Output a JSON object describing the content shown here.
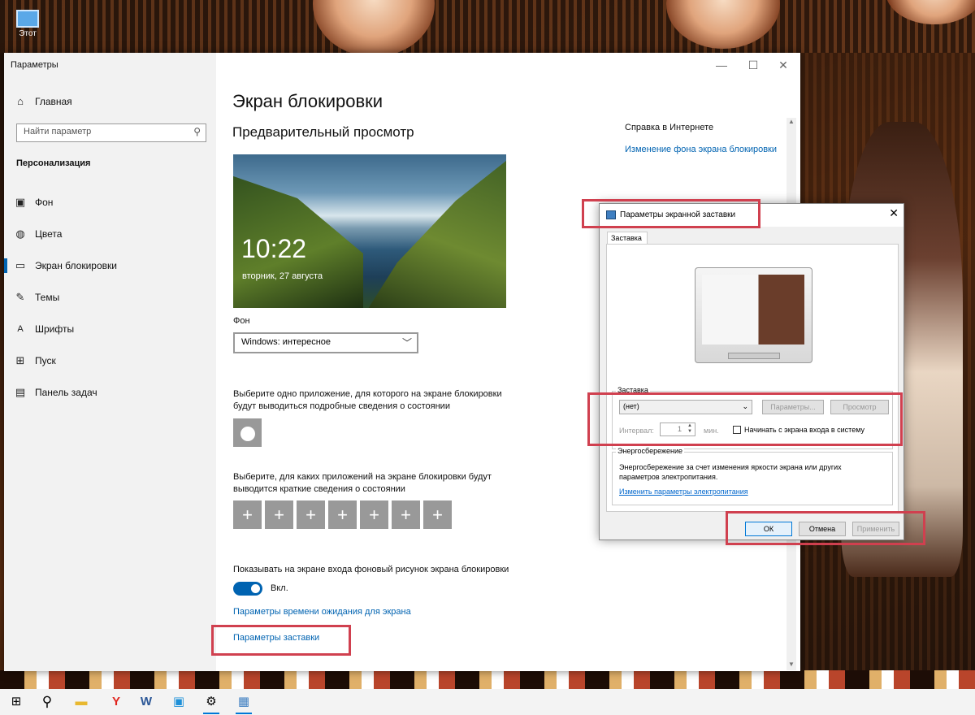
{
  "desktop": {
    "icon_label": "Этот"
  },
  "settings_window": {
    "title": "Параметры",
    "controls": {
      "minimize": "—",
      "maximize": "☐",
      "close": "✕"
    },
    "sidebar": {
      "home": "Главная",
      "search_placeholder": "Найти параметр",
      "section": "Персонализация",
      "items": [
        {
          "label": "Фон",
          "icon": "image-icon"
        },
        {
          "label": "Цвета",
          "icon": "palette-icon"
        },
        {
          "label": "Экран блокировки",
          "icon": "lockscreen-icon"
        },
        {
          "label": "Темы",
          "icon": "themes-icon"
        },
        {
          "label": "Шрифты",
          "icon": "fonts-icon"
        },
        {
          "label": "Пуск",
          "icon": "start-icon"
        },
        {
          "label": "Панель задач",
          "icon": "taskbar-icon"
        }
      ]
    },
    "main": {
      "title": "Экран блокировки",
      "preview_heading": "Предварительный просмотр",
      "preview_time": "10:22",
      "preview_date": "вторник, 27 августа",
      "background_label": "Фон",
      "background_value": "Windows: интересное",
      "detailed_status_text": "Выберите одно приложение, для которого на экране блокировки будут выводиться подробные сведения о состоянии",
      "quick_status_text": "Выберите, для каких приложений на экране блокировки будут выводится краткие сведения о состоянии",
      "quick_tiles": [
        "+",
        "+",
        "+",
        "+",
        "+",
        "+",
        "+"
      ],
      "show_bg_text": "Показывать на экране входа фоновый рисунок экрана блокировки",
      "toggle_state": "Вкл.",
      "timeout_link": "Параметры времени ожидания для экрана",
      "screensaver_link": "Параметры заставки"
    },
    "help": {
      "heading": "Справка в Интернете",
      "link": "Изменение фона экрана блокировки"
    }
  },
  "dialog": {
    "title": "Параметры экранной заставки",
    "tab": "Заставка",
    "screensaver_group": "Заставка",
    "screensaver_value": "(нет)",
    "btn_params": "Параметры...",
    "btn_preview": "Просмотр",
    "interval_label": "Интервал:",
    "interval_value": "1",
    "interval_unit": "мин.",
    "logon_checkbox": "Начинать с экрана входа в систему",
    "power_group": "Энергосбережение",
    "power_text": "Энергосбережение за счет изменения яркости экрана или других параметров электропитания.",
    "power_link": "Изменить параметры электропитания",
    "btn_ok": "ОК",
    "btn_cancel": "Отмена",
    "btn_apply": "Применить"
  },
  "taskbar": {
    "items": [
      "start-icon",
      "search-icon",
      "explorer-icon",
      "yandex-icon",
      "word-icon",
      "photos-icon",
      "settings-icon",
      "screensaver-icon"
    ]
  }
}
